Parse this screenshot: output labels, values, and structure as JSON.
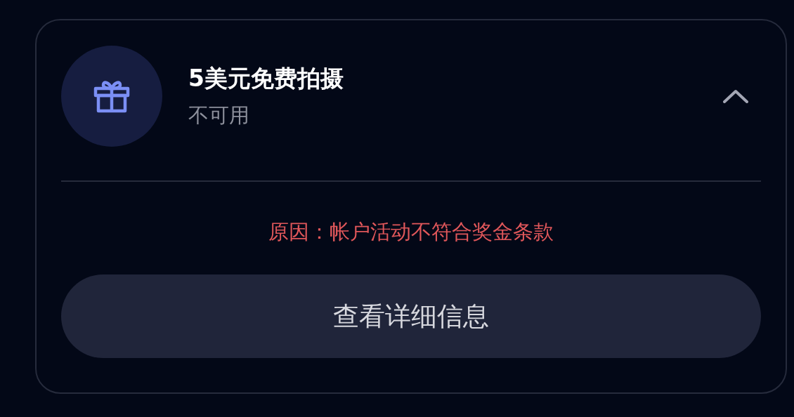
{
  "reward": {
    "title": "5美元免费拍摄",
    "status": "不可用",
    "expanded": true,
    "reason": "原因：帐户活动不符合奖金条款",
    "details_button": "查看详细信息"
  }
}
